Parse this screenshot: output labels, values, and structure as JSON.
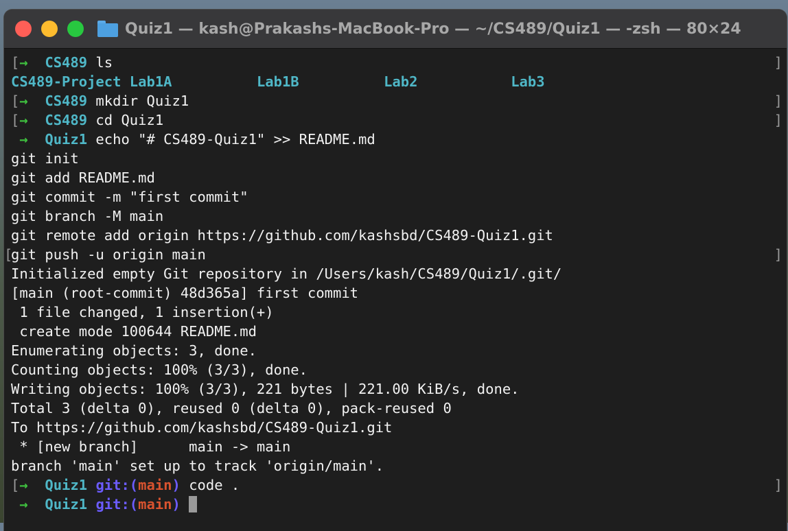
{
  "window": {
    "title": "Quiz1 — kash@Prakashs-MacBook-Pro — ~/CS489/Quiz1 — -zsh — 80×24",
    "folder_icon": "folder-icon"
  },
  "colors": {
    "prompt_arrow": "#3fbf3f",
    "directory": "#4fb7c7",
    "git_label": "#6c5cff",
    "branch": "#d9532f",
    "background": "#1e1e1e",
    "text": "#f2f2f2"
  },
  "prompt": {
    "arrow": "→",
    "git_label": "git:(",
    "branch": "main",
    "git_close": ")"
  },
  "terminal": {
    "l1": {
      "dir": "CS489",
      "cmd": " ls"
    },
    "ls_output": {
      "items": [
        "CS489-Project",
        "Lab1A",
        "Lab1B",
        "Lab2",
        "Lab3"
      ]
    },
    "l3": {
      "dir": "CS489",
      "cmd": " mkdir Quiz1"
    },
    "l4": {
      "dir": "CS489",
      "cmd": " cd Quiz1"
    },
    "l5": {
      "dir": "Quiz1",
      "cmd": " echo \"# CS489-Quiz1\" >> README.md"
    },
    "output": [
      "git init",
      "git add README.md",
      "git commit -m \"first commit\"",
      "git branch -M main",
      "git remote add origin https://github.com/kashsbd/CS489-Quiz1.git",
      "git push -u origin main",
      "Initialized empty Git repository in /Users/kash/CS489/Quiz1/.git/",
      "[main (root-commit) 48d365a] first commit",
      " 1 file changed, 1 insertion(+)",
      " create mode 100644 README.md",
      "Enumerating objects: 3, done.",
      "Counting objects: 100% (3/3), done.",
      "Writing objects: 100% (3/3), 221 bytes | 221.00 KiB/s, done.",
      "Total 3 (delta 0), reused 0 (delta 0), pack-reused 0",
      "To https://github.com/kashsbd/CS489-Quiz1.git",
      " * [new branch]      main -> main",
      "branch 'main' set up to track 'origin/main'."
    ],
    "l23": {
      "dir": "Quiz1",
      "cmd": " code ."
    },
    "l24": {
      "dir": "Quiz1",
      "cmd": " "
    }
  }
}
